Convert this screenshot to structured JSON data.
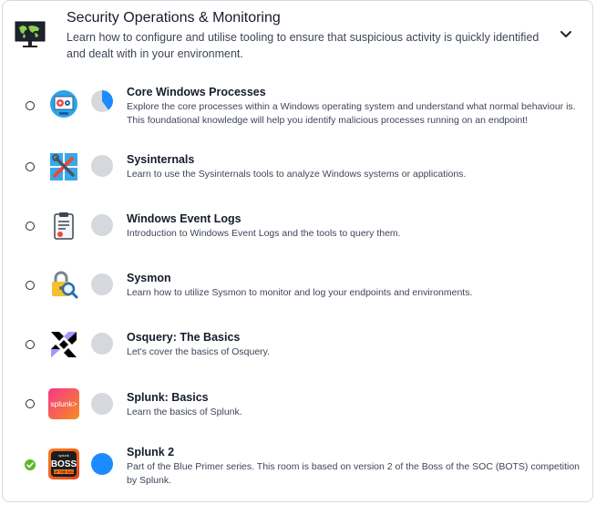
{
  "module": {
    "title": "Security Operations & Monitoring",
    "description": "Learn how to configure and utilise tooling to ensure that suspicious activity is quickly identified and dealt with in your environment.",
    "icon": "monitor-world-map-icon",
    "expand_icon": "chevron-down-icon"
  },
  "rooms": [
    {
      "title": "Core Windows Processes",
      "description": "Explore the core processes within a Windows operating system and understand what normal behaviour is. This foundational knowledge will help you identify malicious processes running on an endpoint!",
      "icon": "windows-gears-icon",
      "progress": 0.4,
      "completed": false
    },
    {
      "title": "Sysinternals",
      "description": "Learn to use the Sysinternals tools to analyze Windows systems or applications.",
      "icon": "windows-tools-icon",
      "progress": 0,
      "completed": false
    },
    {
      "title": "Windows Event Logs",
      "description": "Introduction to Windows Event Logs and the tools to query them.",
      "icon": "clipboard-log-icon",
      "progress": 0,
      "completed": false
    },
    {
      "title": "Sysmon",
      "description": "Learn how to utilize Sysmon to monitor and log your endpoints and environments.",
      "icon": "lock-magnifier-icon",
      "progress": 0,
      "completed": false
    },
    {
      "title": "Osquery: The Basics",
      "description": "Let's cover the basics of Osquery.",
      "icon": "osquery-logo-icon",
      "progress": 0,
      "completed": false
    },
    {
      "title": "Splunk: Basics",
      "description": "Learn the basics of Splunk.",
      "icon": "splunk-logo-icon",
      "progress": 0,
      "completed": false
    },
    {
      "title": "Splunk 2",
      "description": "Part of the Blue Primer series. This room is based on version 2 of the Boss of the SOC (BOTS) competition by Splunk.",
      "icon": "boss-of-the-soc-icon",
      "progress": 1,
      "completed": true
    }
  ],
  "icon_text": {
    "splunk": "splunk>",
    "boss_top": "splunk",
    "boss_main": "BOSS",
    "boss_sub": "OF THE SOC"
  },
  "colors": {
    "progress_fill": "#1a8cff",
    "progress_empty": "#d5d8dd",
    "completed_check": "#5eb82c"
  }
}
